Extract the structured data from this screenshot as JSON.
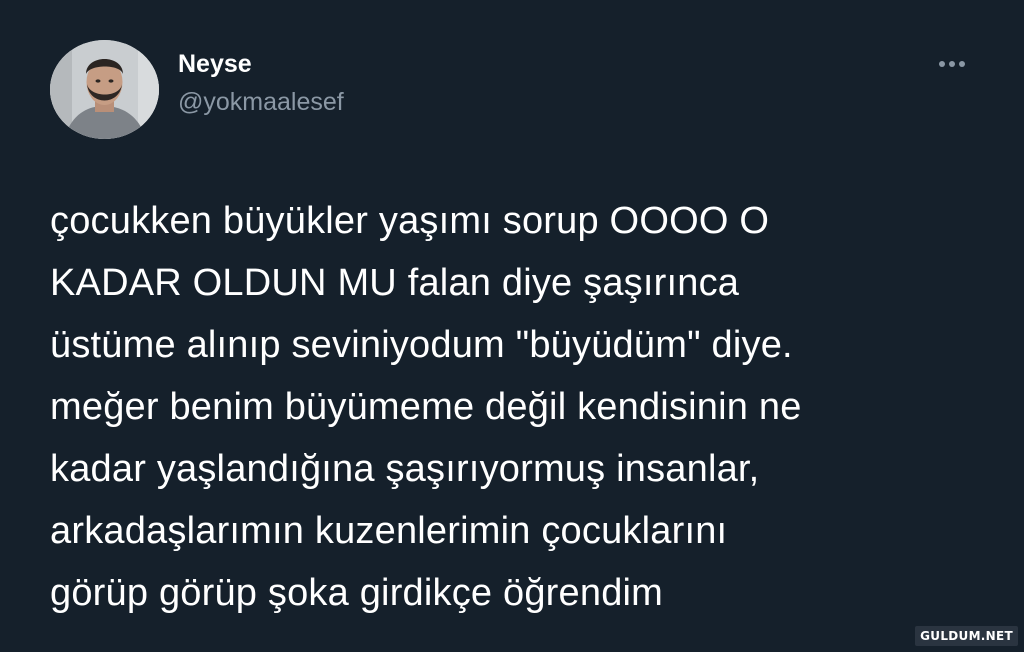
{
  "author": {
    "name": "Neyse",
    "handle": "@yokmaalesef"
  },
  "more_menu": {
    "icon": "more-horizontal-icon"
  },
  "tweet": {
    "lines": [
      "çocukken büyükler yaşımı sorup OOOO O",
      "KADAR OLDUN MU falan diye şaşırınca",
      "üstüme alınıp seviniyodum \"büyüdüm\" diye.",
      "meğer benim büyümeme değil kendisinin ne",
      "kadar yaşlandığına şaşırıyormuş insanlar,",
      "arkadaşlarımın kuzenlerimin çocuklarını",
      "görüp görüp şoka girdikçe öğrendim"
    ]
  },
  "watermark": "GULDUM.NET",
  "colors": {
    "background": "#15202b",
    "text": "#ffffff",
    "secondary_text": "#8b98a5"
  }
}
